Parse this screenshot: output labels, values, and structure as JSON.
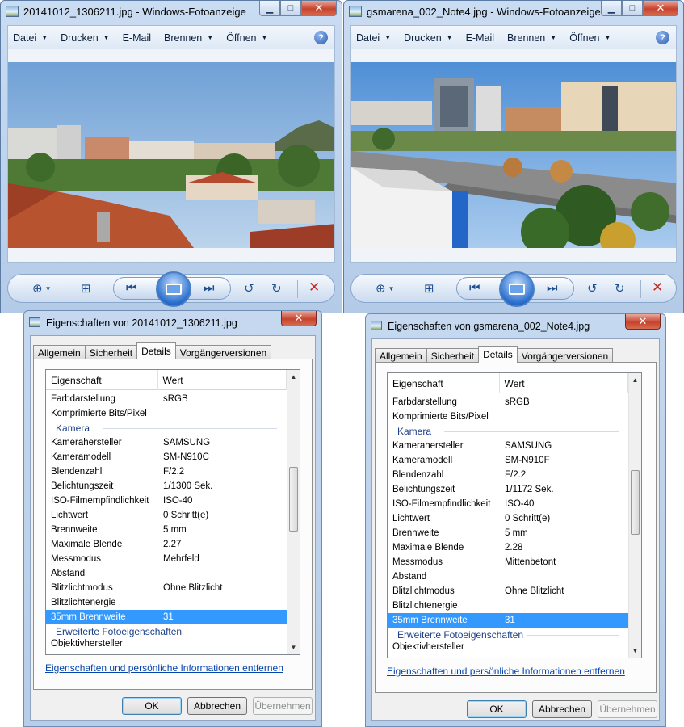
{
  "viewers": [
    {
      "title": "20141012_1306211.jpg - Windows-Fotoanzeige",
      "menu": [
        "Datei",
        "Drucken",
        "E-Mail",
        "Brennen",
        "Öffnen"
      ],
      "photo": "left"
    },
    {
      "title": "gsmarena_002_Note4.jpg - Windows-Fotoanzeige",
      "menu": [
        "Datei",
        "Drucken",
        "E-Mail",
        "Brennen",
        "Öffnen"
      ],
      "photo": "right"
    }
  ],
  "dialogs": [
    {
      "title": "Eigenschaften von 20141012_1306211.jpg",
      "tabs": [
        "Allgemein",
        "Sicherheit",
        "Details",
        "Vorgängerversionen"
      ],
      "active_tab": "Details",
      "col_property": "Eigenschaft",
      "col_value": "Wert",
      "rows": [
        {
          "p": "Farbdarstellung",
          "v": "sRGB"
        },
        {
          "p": "Komprimierte Bits/Pixel",
          "v": ""
        },
        {
          "group": "Kamera"
        },
        {
          "p": "Kamerahersteller",
          "v": "SAMSUNG"
        },
        {
          "p": "Kameramodell",
          "v": "SM-N910C"
        },
        {
          "p": "Blendenzahl",
          "v": "F/2.2"
        },
        {
          "p": "Belichtungszeit",
          "v": "1/1300 Sek."
        },
        {
          "p": "ISO-Filmempfindlichkeit",
          "v": "ISO-40"
        },
        {
          "p": "Lichtwert",
          "v": "0 Schritt(e)"
        },
        {
          "p": "Brennweite",
          "v": "5 mm"
        },
        {
          "p": "Maximale Blende",
          "v": "2.27"
        },
        {
          "p": "Messmodus",
          "v": "Mehrfeld"
        },
        {
          "p": "Abstand",
          "v": ""
        },
        {
          "p": "Blitzlichtmodus",
          "v": "Ohne Blitzlicht"
        },
        {
          "p": "Blitzlichtenergie",
          "v": ""
        },
        {
          "p": "35mm Brennweite",
          "v": "31",
          "selected": true
        },
        {
          "group": "Erweiterte Fotoeigenschaften"
        },
        {
          "p": "Objektivhersteller",
          "v": "",
          "clip": true
        }
      ],
      "link": "Eigenschaften und persönliche Informationen entfernen",
      "ok": "OK",
      "cancel": "Abbrechen",
      "apply": "Übernehmen"
    },
    {
      "title": "Eigenschaften von gsmarena_002_Note4.jpg",
      "tabs": [
        "Allgemein",
        "Sicherheit",
        "Details",
        "Vorgängerversionen"
      ],
      "active_tab": "Details",
      "col_property": "Eigenschaft",
      "col_value": "Wert",
      "rows": [
        {
          "p": "Farbdarstellung",
          "v": "sRGB"
        },
        {
          "p": "Komprimierte Bits/Pixel",
          "v": ""
        },
        {
          "group": "Kamera"
        },
        {
          "p": "Kamerahersteller",
          "v": "SAMSUNG"
        },
        {
          "p": "Kameramodell",
          "v": "SM-N910F"
        },
        {
          "p": "Blendenzahl",
          "v": "F/2.2"
        },
        {
          "p": "Belichtungszeit",
          "v": "1/1172 Sek."
        },
        {
          "p": "ISO-Filmempfindlichkeit",
          "v": "ISO-40"
        },
        {
          "p": "Lichtwert",
          "v": "0 Schritt(e)"
        },
        {
          "p": "Brennweite",
          "v": "5 mm"
        },
        {
          "p": "Maximale Blende",
          "v": "2.28"
        },
        {
          "p": "Messmodus",
          "v": "Mittenbetont"
        },
        {
          "p": "Abstand",
          "v": ""
        },
        {
          "p": "Blitzlichtmodus",
          "v": "Ohne Blitzlicht"
        },
        {
          "p": "Blitzlichtenergie",
          "v": ""
        },
        {
          "p": "35mm Brennweite",
          "v": "31",
          "selected": true
        },
        {
          "group": "Erweiterte Fotoeigenschaften"
        },
        {
          "p": "Objektivhersteller",
          "v": "",
          "clip": true
        }
      ],
      "link": "Eigenschaften und persönliche Informationen entfernen",
      "ok": "OK",
      "cancel": "Abbrechen",
      "apply": "Übernehmen"
    }
  ],
  "icons": {
    "window_min": "minimize-icon",
    "window_max": "maximize-icon",
    "window_close": "close-icon",
    "help": "help-icon",
    "zoom": "zoom-icon",
    "fit": "fit-to-window-icon",
    "previous": "previous-icon",
    "slideshow": "slideshow-icon",
    "next": "next-icon",
    "rotate_ccw": "rotate-counterclockwise-icon",
    "rotate_cw": "rotate-clockwise-icon",
    "delete": "delete-icon"
  },
  "colors": {
    "selection": "#3399ff",
    "link": "#0645ad",
    "group_header": "#1a3f86",
    "close_button": "#c7432d"
  }
}
